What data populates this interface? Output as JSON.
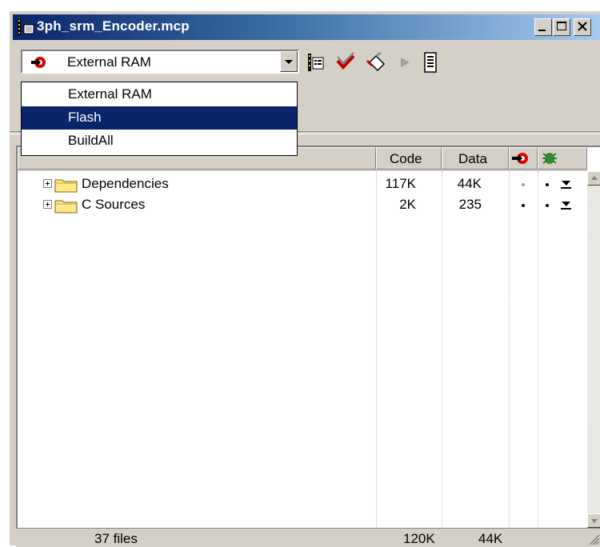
{
  "window": {
    "title": "3ph_srm_Encoder.mcp"
  },
  "toolbar": {
    "build_config": {
      "selected": "External RAM",
      "icon": "build-target-icon"
    },
    "tools": [
      "project-options-icon",
      "check-build-icon",
      "clean-build-icon",
      "run-icon",
      "listing-icon"
    ]
  },
  "dropdown": {
    "options": [
      "External RAM",
      "Flash",
      "BuildAll"
    ],
    "highlighted": "Flash"
  },
  "columns": {
    "file": "",
    "code": "Code",
    "data": "Data",
    "target_icon": "target-icon",
    "debug_icon": "debug-icon"
  },
  "files": [
    {
      "name": "Dependencies",
      "code": "117K",
      "data": "44K"
    },
    {
      "name": "C Sources",
      "code": "2K",
      "data": "235"
    }
  ],
  "status": {
    "count": "37 files",
    "code_total": "120K",
    "data_total": "44K"
  },
  "colors": {
    "title_start": "#0a246a",
    "title_end": "#a6caf0",
    "selection": "#0a246a",
    "chrome": "#d4d0c8"
  }
}
